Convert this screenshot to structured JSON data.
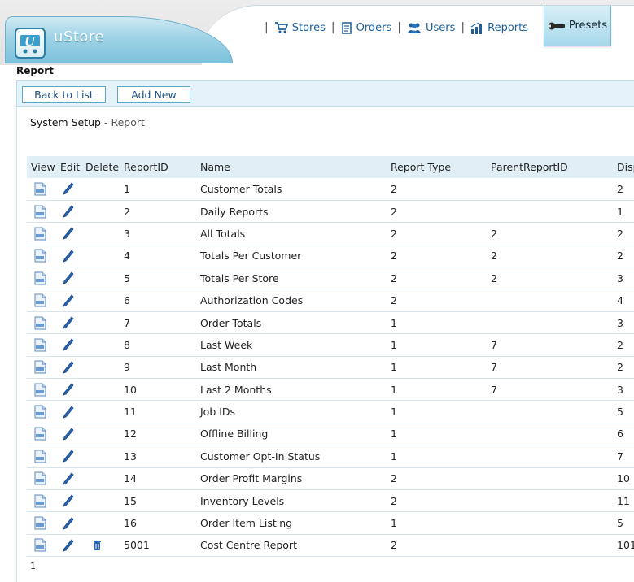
{
  "app": {
    "name": "uStore"
  },
  "nav": {
    "items": [
      {
        "label": "Stores",
        "icon": "cart-icon"
      },
      {
        "label": "Orders",
        "icon": "orders-icon"
      },
      {
        "label": "Users",
        "icon": "users-icon"
      },
      {
        "label": "Reports",
        "icon": "reports-icon"
      }
    ],
    "active": {
      "label": "Presets",
      "icon": "wrench-icon"
    }
  },
  "page": {
    "label": "Report"
  },
  "toolbar": {
    "back_label": "Back to List",
    "add_label": "Add New"
  },
  "breadcrumb": {
    "root": "System Setup",
    "sep": " - ",
    "current": "Report"
  },
  "table": {
    "columns": [
      "View",
      "Edit",
      "Delete",
      "ReportID",
      "Name",
      "Report Type",
      "ParentReportID",
      "Disp"
    ],
    "rows": [
      {
        "id": "1",
        "name": "Customer Totals",
        "type": "2",
        "parent": "",
        "disp": "2",
        "deletable": false
      },
      {
        "id": "2",
        "name": "Daily Reports",
        "type": "2",
        "parent": "",
        "disp": "1",
        "deletable": false
      },
      {
        "id": "3",
        "name": "All Totals",
        "type": "2",
        "parent": "2",
        "disp": "2",
        "deletable": false
      },
      {
        "id": "4",
        "name": "Totals Per Customer",
        "type": "2",
        "parent": "2",
        "disp": "2",
        "deletable": false
      },
      {
        "id": "5",
        "name": "Totals Per Store",
        "type": "2",
        "parent": "2",
        "disp": "3",
        "deletable": false
      },
      {
        "id": "6",
        "name": "Authorization Codes",
        "type": "2",
        "parent": "",
        "disp": "4",
        "deletable": false
      },
      {
        "id": "7",
        "name": "Order Totals",
        "type": "1",
        "parent": "",
        "disp": "3",
        "deletable": false
      },
      {
        "id": "8",
        "name": "Last Week",
        "type": "1",
        "parent": "7",
        "disp": "2",
        "deletable": false
      },
      {
        "id": "9",
        "name": "Last Month",
        "type": "1",
        "parent": "7",
        "disp": "2",
        "deletable": false
      },
      {
        "id": "10",
        "name": "Last 2 Months",
        "type": "1",
        "parent": "7",
        "disp": "3",
        "deletable": false
      },
      {
        "id": "11",
        "name": "Job IDs",
        "type": "1",
        "parent": "",
        "disp": "5",
        "deletable": false
      },
      {
        "id": "12",
        "name": "Offline Billing",
        "type": "1",
        "parent": "",
        "disp": "6",
        "deletable": false
      },
      {
        "id": "13",
        "name": "Customer Opt-In Status",
        "type": "1",
        "parent": "",
        "disp": "7",
        "deletable": false
      },
      {
        "id": "14",
        "name": "Order Profit Margins",
        "type": "2",
        "parent": "",
        "disp": "10",
        "deletable": false
      },
      {
        "id": "15",
        "name": "Inventory Levels",
        "type": "2",
        "parent": "",
        "disp": "11",
        "deletable": false
      },
      {
        "id": "16",
        "name": "Order Item Listing",
        "type": "1",
        "parent": "",
        "disp": "5",
        "deletable": false
      },
      {
        "id": "5001",
        "name": "Cost Centre Report",
        "type": "2",
        "parent": "",
        "disp": "101",
        "deletable": true
      }
    ]
  },
  "pager": {
    "page": "1"
  },
  "colors": {
    "accent": "#7cc2dc",
    "link": "#1d5f9a",
    "header_row": "#e0eff6"
  }
}
